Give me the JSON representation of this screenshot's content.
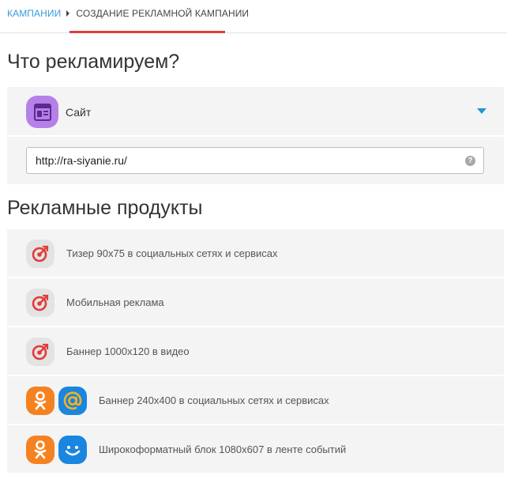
{
  "breadcrumb": {
    "link": "КАМПАНИИ",
    "current": "СОЗДАНИЕ РЕКЛАМНОЙ КАМПАНИИ"
  },
  "sections": {
    "what_title": "Что рекламируем?",
    "products_title": "Рекламные продукты"
  },
  "ad_object": {
    "type_label": "Сайт",
    "type_icon": "website-icon",
    "url_value": "http://ra-siyanie.ru/",
    "help_glyph": "?"
  },
  "products": [
    {
      "label": "Тизер 90x75 в социальных сетях и сервисах",
      "icons": [
        "target-icon"
      ]
    },
    {
      "label": "Мобильная реклама",
      "icons": [
        "target-icon"
      ]
    },
    {
      "label": "Баннер 1000x120 в видео",
      "icons": [
        "target-icon"
      ]
    },
    {
      "label": "Баннер 240x400 в социальных сетях и сервисах",
      "icons": [
        "odnoklassniki-icon",
        "mail-at-icon"
      ]
    },
    {
      "label": "Широкоформатный блок 1080x607 в ленте событий",
      "icons": [
        "odnoklassniki-icon",
        "smile-icon"
      ]
    }
  ],
  "colors": {
    "link": "#3a9bd9",
    "active_underline": "#e23b3b",
    "caret": "#2196d3",
    "site_icon_bg": "#b581e8",
    "target_red": "#e23b3b",
    "ok_orange": "#f58220",
    "mail_blue": "#1a86e0"
  }
}
